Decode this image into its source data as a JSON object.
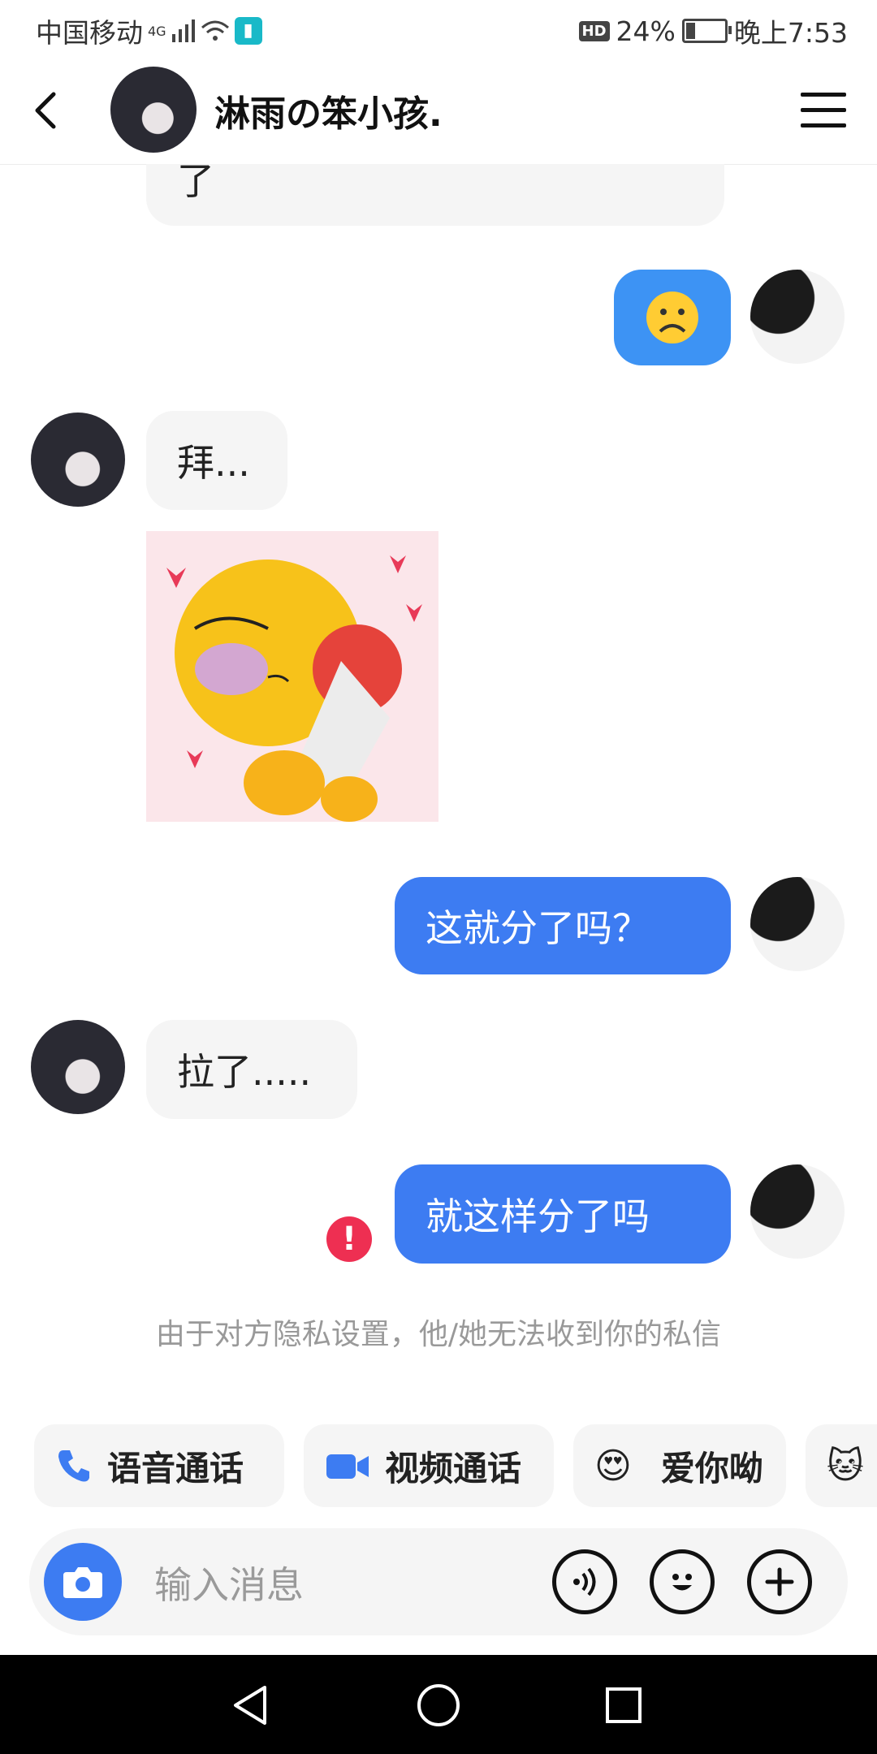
{
  "status_bar": {
    "carrier": "中国移动",
    "network": "4G",
    "hd_badge": "HD",
    "battery_percent": "24%",
    "time": "晚上7:53",
    "battery_level": 0.24
  },
  "header": {
    "contact_name": "淋雨の笨小孩."
  },
  "messages": {
    "partial_top": "了",
    "m1_emoji": "☹",
    "m2_text": "拜...",
    "m4_text": "这就分了吗？",
    "m5_text": "拉了.....",
    "m6_text": "就这样分了吗",
    "m6_error": "!"
  },
  "notice": "由于对方隐私设置，他/她无法收到你的私信",
  "quick_actions": {
    "voice_call": "语音通话",
    "video_call": "视频通话",
    "love_you": "爱你呦",
    "love_emoji": "😍",
    "cat_emoji": "🐱"
  },
  "input": {
    "placeholder": "输入消息"
  },
  "colors": {
    "accent_blue": "#3d7cf2",
    "error_red": "#ee2f52",
    "bubble_gray": "#f5f5f5"
  },
  "icons": [
    "back-arrow-icon",
    "menu-icon",
    "camera-icon",
    "voice-icon",
    "emoji-icon",
    "plus-icon",
    "phone-icon",
    "video-icon",
    "nav-back-icon",
    "nav-home-icon",
    "nav-recents-icon"
  ]
}
